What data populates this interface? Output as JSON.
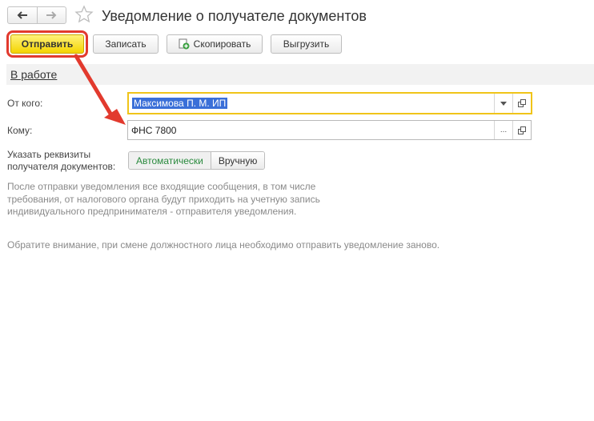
{
  "window": {
    "title": "Уведомление о получателе документов",
    "nav": {
      "back_icon": "arrow-left-icon",
      "forward_icon": "arrow-right-icon",
      "favorite_icon": "star-icon"
    }
  },
  "toolbar": {
    "send_label": "Отправить",
    "write_label": "Записать",
    "copy_label": "Скопировать",
    "export_label": "Выгрузить"
  },
  "status": {
    "label": "В работе"
  },
  "form": {
    "from_label": "От кого:",
    "from_value": "Максимова П. М. ИП",
    "to_label": "Кому:",
    "to_value": "ФНС 7800",
    "to_select_button": "...",
    "requisites_label_line1": "Указать реквизиты",
    "requisites_label_line2": "получателя документов:",
    "requisites_options": [
      "Автоматически",
      "Вручную"
    ],
    "requisites_selected": "Автоматически"
  },
  "notes": {
    "info_text": "После отправки уведомления все входящие сообщения, в том числе требования, от налогового органа будут приходить на учетную запись индивидуального предпринимателя - отправителя уведомления.",
    "warning_text": "Обратите внимание, при смене должностного лица необходимо отправить уведомление заново."
  },
  "colors": {
    "send_button": "#f4d400",
    "highlight_outline": "#e23a2e",
    "active_field_border": "#f0c419",
    "selected_text_bg": "#3a6fd8",
    "toggle_active_text": "#2a8a3e",
    "note_text": "#8a8a8a"
  }
}
